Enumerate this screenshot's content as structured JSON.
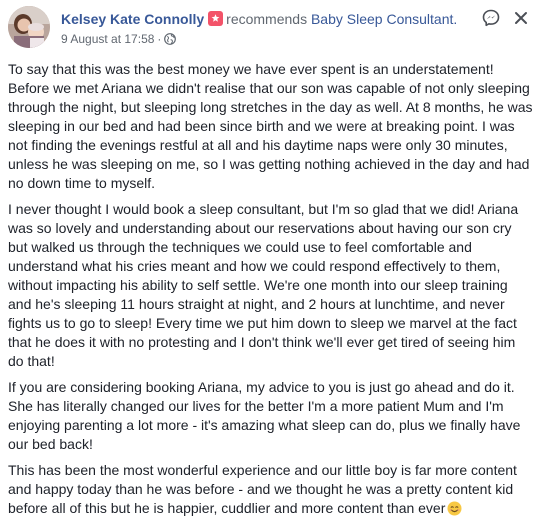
{
  "post": {
    "author": "Kelsey Kate Connolly",
    "action": "recommends",
    "target": "Baby Sleep Consultant.",
    "timestamp": "9 August at 17:58",
    "separator": "·",
    "paragraphs": [
      "To say that this was the best money we have ever spent is an understatement! Before we met Ariana we didn't realise that our son was capable of not only sleeping through the night, but sleeping long stretches in the day as well. At 8 months, he was sleeping in our bed and had been since birth and we were at breaking point. I was not finding the evenings restful at all and his daytime naps were only 30 minutes, unless he was sleeping on me, so I was getting nothing achieved in the day and had no down time to myself.",
      "I never thought I would book a sleep consultant, but I'm so glad that we did! Ariana was so lovely and understanding about our reservations about having our son cry but walked us through the techniques we could use to feel comfortable and understand what his cries meant and how we could respond effectively to them, without impacting his ability to self settle. We're one month into our sleep training and he's sleeping 11 hours straight at night, and 2 hours at lunchtime, and never fights us to go to sleep! Every time we put him down to sleep we marvel at the fact that he does it with no protesting and I don't think we'll ever get tired of seeing him do that!",
      "If you are considering booking Ariana, my advice to you is just go ahead and do it. She has literally changed our lives for the better I'm a more patient Mum and I'm enjoying parenting a lot more - it's amazing what sleep can do, plus we finally have our bed back!",
      "This has been the most wonderful experience and our little boy is far more content and happy today than he was before - and we thought he was a pretty content kid before all of this but he is happier, cuddlier and more content than ever"
    ]
  },
  "icons": {
    "recommend": "recommend-icon",
    "privacy": "globe-icon",
    "message": "messenger-icon",
    "close": "close-icon",
    "emoji": "smiling-emoji-icon"
  },
  "colors": {
    "link": "#385898",
    "meta": "#606770",
    "text": "#1d2129",
    "recommend_badge": "#f35369",
    "emoji": "#f7c844"
  }
}
